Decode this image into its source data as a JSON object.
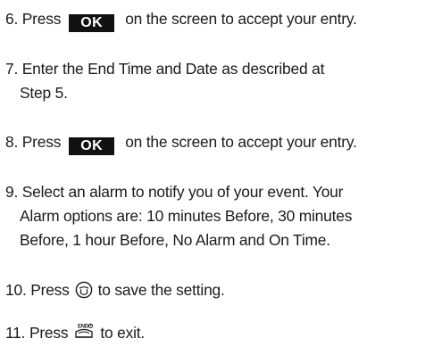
{
  "steps": [
    {
      "number": "6.",
      "before": "Press",
      "button_label": "OK",
      "after": "on the screen to accept your entry."
    },
    {
      "number": "7.",
      "line1": "Enter the End Time and Date as described at",
      "line2": "Step 5."
    },
    {
      "number": "8.",
      "before": "Press",
      "button_label": "OK",
      "after": "on the screen to accept your entry."
    },
    {
      "number": "9.",
      "line1": "Select an alarm to notify you of your event. Your",
      "line2": "Alarm options are: 10 minutes Before, 30 minutes",
      "line3": "Before, 1 hour Before, No Alarm and On Time."
    },
    {
      "number": "10.",
      "before": "Press",
      "icon": "center-select-key-icon",
      "after": "to save the setting."
    },
    {
      "number": "11.",
      "before": "Press",
      "icon": "end-key-icon",
      "icon_text": "END",
      "after": "to exit."
    }
  ]
}
